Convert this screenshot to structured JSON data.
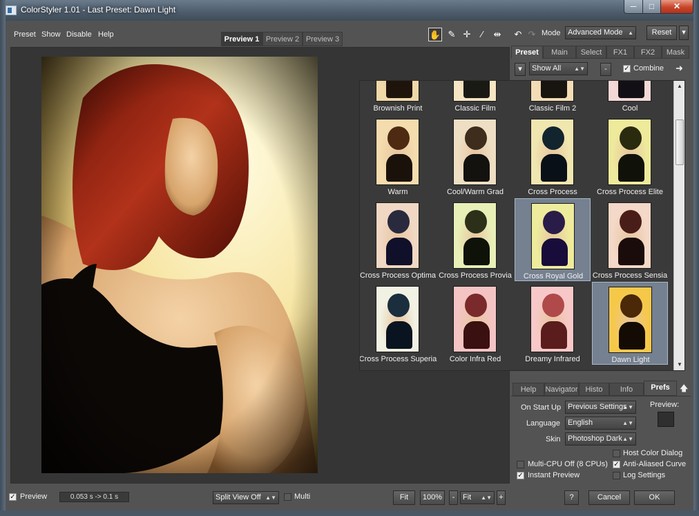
{
  "window": {
    "title": "ColorStyler 1.01 - Last Preset: Dawn Light",
    "controls": {
      "minimize": "─",
      "maximize": "□",
      "close": "✕"
    }
  },
  "menu": [
    "Preset",
    "Show",
    "Disable",
    "Help"
  ],
  "preview_tabs": [
    {
      "label": "Preview 1",
      "active": true
    },
    {
      "label": "Preview 2",
      "active": false
    },
    {
      "label": "Preview 3",
      "active": false
    }
  ],
  "tools": [
    {
      "icon": "hand-icon",
      "glyph": "✋",
      "selected": true
    },
    {
      "icon": "eyedropper-icon",
      "glyph": "✎",
      "selected": false
    },
    {
      "icon": "crosshair-icon",
      "glyph": "✛",
      "selected": false
    },
    {
      "icon": "brush-icon",
      "glyph": "⁄",
      "selected": false
    },
    {
      "icon": "split-compare-icon",
      "glyph": "⇹",
      "selected": false
    }
  ],
  "history": {
    "undo_glyph": "↶",
    "redo_glyph": "↷"
  },
  "mode": {
    "label": "Mode",
    "value": "Advanced Mode"
  },
  "reset": {
    "label": "Reset",
    "dropdown_glyph": "▾"
  },
  "right_tabs": [
    {
      "label": "Preset",
      "active": true
    },
    {
      "label": "Main",
      "active": false
    },
    {
      "label": "Select",
      "active": false
    },
    {
      "label": "FX1",
      "active": false
    },
    {
      "label": "FX2",
      "active": false
    },
    {
      "label": "Mask",
      "active": false
    }
  ],
  "preset_bar": {
    "menu_glyph": "▾",
    "filter": "Show All",
    "minus": "-",
    "combine_label": "Combine",
    "combine_checked": true,
    "arrow_glyph": "➜"
  },
  "presets": [
    {
      "label": "Brownish Print",
      "hair": "#4a2a12",
      "dress": "#1e140c",
      "bg": "#f0d8a8",
      "partial": true
    },
    {
      "label": "Classic Film",
      "hair": "#3a2a18",
      "dress": "#1a1a14",
      "bg": "#f6e6c4",
      "partial": true
    },
    {
      "label": "Classic Film 2",
      "hair": "#40281a",
      "dress": "#181410",
      "bg": "#f2ddb6",
      "partial": true
    },
    {
      "label": "Cool",
      "hair": "#3a1c20",
      "dress": "#121016",
      "bg": "#f4d8d8",
      "partial": true
    },
    {
      "label": "Warm",
      "hair": "#4e2a12",
      "dress": "#1a120a",
      "bg": "#f4dcae"
    },
    {
      "label": "Cool/Warm Grad",
      "hair": "#3e2c1c",
      "dress": "#14120e",
      "bg": "#eedfc4"
    },
    {
      "label": "Cross Process",
      "hair": "#12242e",
      "dress": "#0a1018",
      "bg": "#f0e6b0"
    },
    {
      "label": "Cross Process Elite",
      "hair": "#2a2a0e",
      "dress": "#10120a",
      "bg": "#eeea9c"
    },
    {
      "label": "Cross Process Optima",
      "hair": "#2a2a3e",
      "dress": "#10102a",
      "bg": "#f0d8c4"
    },
    {
      "label": "Cross Process Provia",
      "hair": "#2c3018",
      "dress": "#0e1208",
      "bg": "#e8f0b8"
    },
    {
      "label": "Cross Royal Gold",
      "hair": "#2a1c48",
      "dress": "#180c3a",
      "bg": "#eeec9c",
      "selected": true
    },
    {
      "label": "Cross Process Sensia",
      "hair": "#4a1e18",
      "dress": "#1a0c0a",
      "bg": "#f4d8c8"
    },
    {
      "label": "Cross Process Superia",
      "hair": "#1a2e3e",
      "dress": "#0a1420",
      "bg": "#f2f2e4"
    },
    {
      "label": "Color Infra Red",
      "hair": "#7a2a2a",
      "dress": "#3a1010",
      "bg": "#f4c4c4"
    },
    {
      "label": "Dreamy Infrared",
      "hair": "#b04a4a",
      "dress": "#5a1c1c",
      "bg": "#f8c8c8"
    },
    {
      "label": "Dawn Light",
      "hair": "#4a2808",
      "dress": "#140c04",
      "bg": "#f6c84a",
      "selected": true
    }
  ],
  "bottom_tabs": [
    {
      "label": "Help",
      "active": false
    },
    {
      "label": "Navigator",
      "active": false
    },
    {
      "label": "Histo",
      "active": false
    },
    {
      "label": "Info",
      "active": false
    },
    {
      "label": "Prefs",
      "active": true
    }
  ],
  "collapse_glyph": "🡅",
  "prefs": {
    "on_start_up_label": "On Start Up",
    "on_start_up_value": "Previous Settings",
    "language_label": "Language",
    "language_value": "English",
    "skin_label": "Skin",
    "skin_value": "Photoshop Dark",
    "preview_label": "Preview:",
    "host_color_dialog": {
      "label": "Host Color Dialog",
      "checked": false
    },
    "multi_cpu": {
      "label": "Multi-CPU Off (8 CPUs)",
      "checked": false
    },
    "anti_aliased": {
      "label": "Anti-Aliased Curve",
      "checked": true
    },
    "instant_preview": {
      "label": "Instant Preview",
      "checked": true
    },
    "log_settings": {
      "label": "Log Settings",
      "checked": false
    }
  },
  "footer": {
    "preview_label": "Preview",
    "preview_checked": true,
    "timing": "0.053 s -> 0.1 s",
    "split_view": "Split View Off",
    "multi_label": "Multi",
    "fit_button": "Fit",
    "zoom_value": "100%",
    "zoom_out": "-",
    "zoom_combo": "Fit",
    "zoom_in": "+",
    "help_button": "?",
    "cancel_button": "Cancel",
    "ok_button": "OK"
  },
  "colors": {
    "panel_bg": "#535353",
    "dark_bg": "#3a3a3a",
    "selection": "#a5b9d7",
    "title_bar": "#4d5c6b",
    "close_red": "#c7452a"
  }
}
